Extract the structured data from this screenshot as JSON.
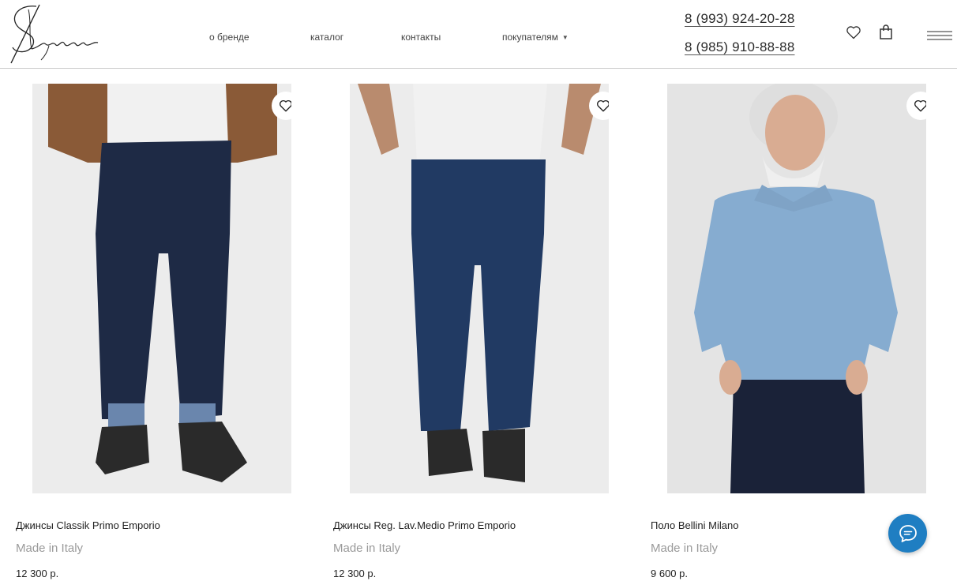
{
  "header": {
    "logo_text": "Segnatore",
    "nav": [
      {
        "label": "о бренде"
      },
      {
        "label": "каталог"
      },
      {
        "label": "контакты"
      },
      {
        "label": "покупателям"
      }
    ],
    "phones": [
      "8 (993) 924-20-28",
      "8 (985) 910-88-88"
    ],
    "icons": [
      "heart-icon",
      "shopping-bag-icon",
      "menu-icon",
      "chevron-down-icon"
    ]
  },
  "products": [
    {
      "name": "Джинсы Classik Primo Emporio",
      "origin": "Made in Italy",
      "price": "12 300 р."
    },
    {
      "name": "Джинсы Reg. Lav.Medio Primo Emporio",
      "origin": "Made in Italy",
      "price": "12 300 р."
    },
    {
      "name": "Поло Bellini Milano",
      "origin": "Made in Italy",
      "price": "9 600 р."
    }
  ],
  "chat": {
    "icon": "chat-bubble-icon"
  },
  "colors": {
    "accent": "#1f7ec2",
    "muted_text": "#9a9a9a",
    "jeans_dark": "#1e2a45",
    "jeans_medium": "#213a63",
    "polo_blue": "#86acd0",
    "divider": "#c9c9c9"
  }
}
